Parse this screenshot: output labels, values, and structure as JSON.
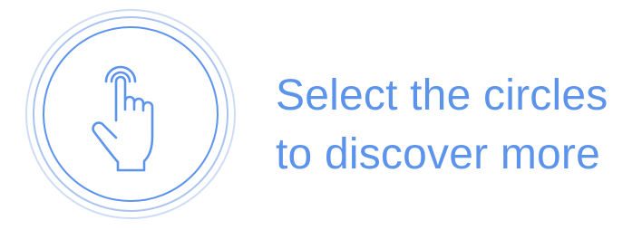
{
  "hint": {
    "line1": "Select the circles",
    "line2": "to discover more",
    "icon": "tap-hand-icon",
    "accent_color": "#5c94ec",
    "ring_colors": [
      "#cfdcf5",
      "#a9c4f0",
      "#5c94ec"
    ]
  }
}
